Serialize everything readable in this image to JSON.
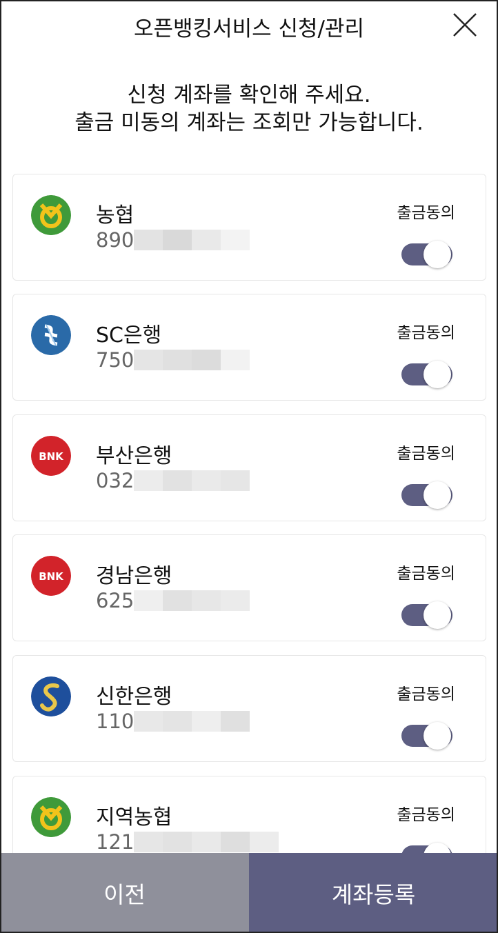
{
  "header": {
    "title": "오픈뱅킹서비스 신청/관리",
    "close_icon": "close-icon"
  },
  "instruction": {
    "line1": "신청 계좌를 확인해 주세요.",
    "line2": "출금 미동의 계좌는 조회만 가능합니다."
  },
  "accounts": [
    {
      "bank": "농협",
      "acct_prefix": "890",
      "consent_label": "출금동의",
      "consent_on": true,
      "logo": "nh-logo-icon",
      "logo_color": "#3f9a3a"
    },
    {
      "bank": "SC은행",
      "acct_prefix": "750",
      "consent_label": "출금동의",
      "consent_on": true,
      "logo": "sc-logo-icon",
      "logo_color": "#2a6aa8"
    },
    {
      "bank": "부산은행",
      "acct_prefix": "032",
      "consent_label": "출금동의",
      "consent_on": true,
      "logo": "bnk-logo-icon",
      "logo_color": "#d2232a"
    },
    {
      "bank": "경남은행",
      "acct_prefix": "625",
      "consent_label": "출금동의",
      "consent_on": true,
      "logo": "bnk-logo-icon",
      "logo_color": "#d2232a"
    },
    {
      "bank": "신한은행",
      "acct_prefix": "110",
      "consent_label": "출금동의",
      "consent_on": true,
      "logo": "shinhan-logo-icon",
      "logo_color": "#1e4f9c"
    },
    {
      "bank": "지역농협",
      "acct_prefix": "121",
      "consent_label": "출금동의",
      "consent_on": true,
      "logo": "nh-logo-icon",
      "logo_color": "#3f9a3a"
    }
  ],
  "footer": {
    "prev_label": "이전",
    "register_label": "계좌등록"
  },
  "colors": {
    "accent": "#5d5e82",
    "prev_button": "#8f909b"
  }
}
